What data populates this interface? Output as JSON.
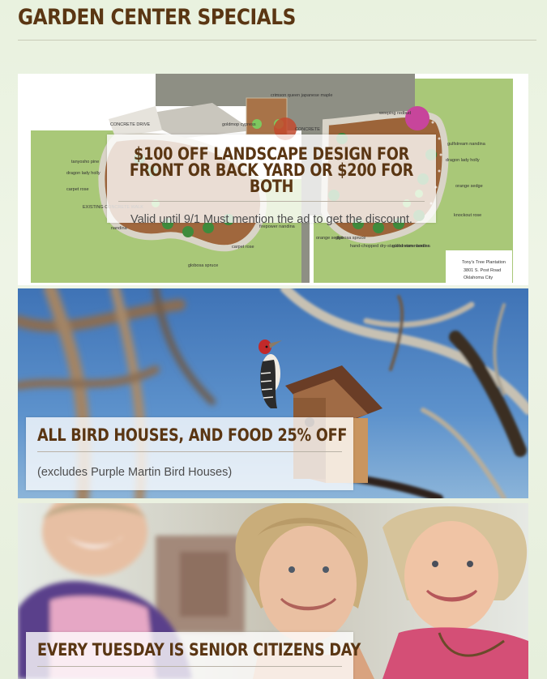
{
  "page": {
    "title": "GARDEN CENTER SPECIALS"
  },
  "specials": [
    {
      "title": "$100 OFF LANDSCAPE DESIGN FOR FRONT OR BACK YARD OR $200 FOR BOTH",
      "detail": "Valid until 9/1 Must mention the ad to get the discount."
    },
    {
      "title": "ALL BIRD HOUSES, AND FOOD 25% OFF",
      "detail": "(excludes Purple Martin Bird Houses)"
    },
    {
      "title": "EVERY TUESDAY IS SENIOR CITIZENS DAY",
      "detail": ""
    }
  ],
  "landscape_plan": {
    "labels": {
      "concrete_drive": "CONCRETE DRIVE",
      "concrete_porch": "CONCRETE",
      "chinese_maple": "crimson queen japanese maple",
      "goldmop": "goldmop cypress",
      "tanyosho": "tanyosho pine",
      "dragon_lady": "dragon lady holly",
      "carpet_rose": "carpet rose",
      "existing_walk": "EXISTING CONCRETE WALK",
      "nandina": "nandina",
      "firepower": "firepower nandina",
      "carpet_rose2": "carpet rose",
      "globosa": "globosa spruce",
      "weeping": "weeping redbud",
      "gulfstream": "gulfstream nandina",
      "dragon_lady2": "dragon lady holly",
      "orange_sedge": "orange sedge",
      "knockout": "knockout rose",
      "stone_border": "hand-chopped dry-stacked stone border",
      "gulfstream2": "gulfstream nandina",
      "orange_sedge2": "orange sedge",
      "globosa2": "globosa spruce"
    },
    "credit": [
      "Tony's Tree Plantation",
      "3801 S. Post Road",
      "Oklahoma City"
    ]
  }
}
